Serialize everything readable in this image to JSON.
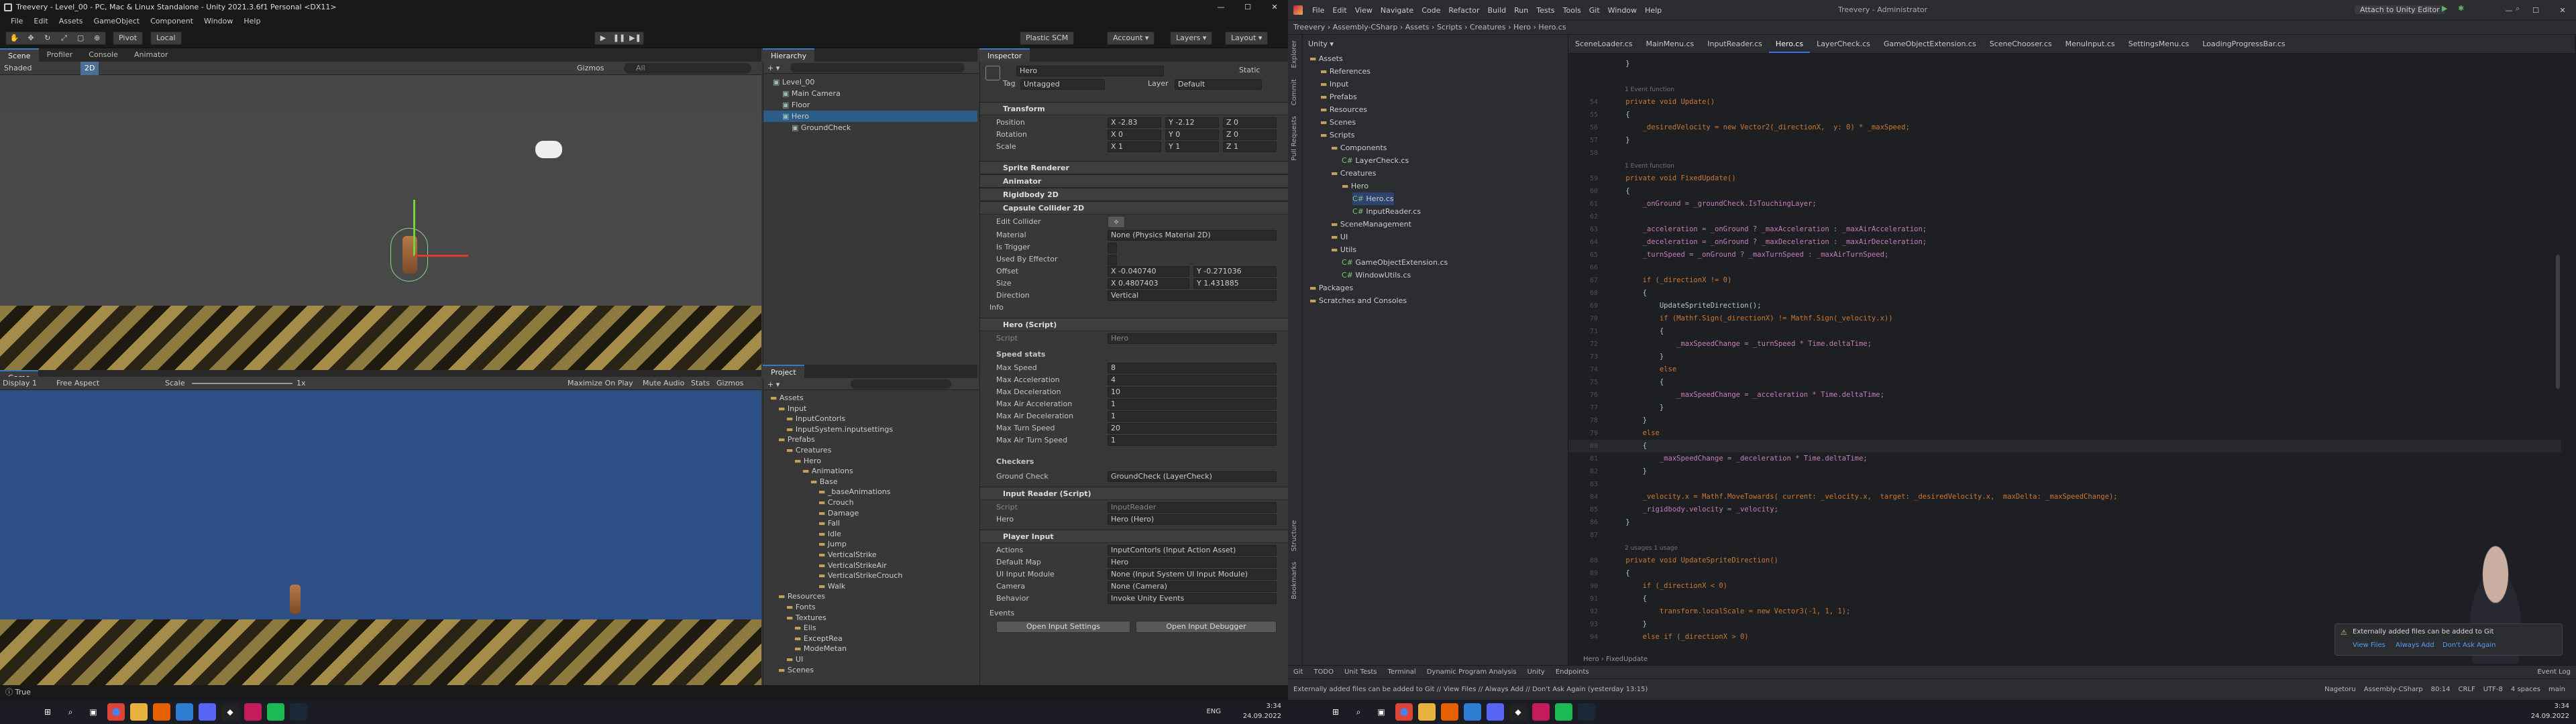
{
  "unity": {
    "title": "Treevery - Level_00 - PC, Mac & Linux Standalone - Unity 2021.3.6f1 Personal <DX11>",
    "menu": [
      "File",
      "Edit",
      "Assets",
      "GameObject",
      "Component",
      "Window",
      "Help"
    ],
    "toolbar": {
      "pivot": "Pivot",
      "local": "Local",
      "scm": "Plastic SCM",
      "account": "Account",
      "layers": "Layers",
      "layout": "Layout"
    },
    "scene_tabs": [
      "Scene",
      "Profiler",
      "Console",
      "Animator"
    ],
    "scene_bar": {
      "shading": "Shaded",
      "mode": "2D",
      "gizmos": "Gizmos",
      "search_ph": "All"
    },
    "game_tab": "Game",
    "game_bar": {
      "display": "Display 1",
      "aspect": "Free Aspect",
      "scale_label": "Scale",
      "scale_value": "1x",
      "maximize": "Maximize On Play",
      "mute": "Mute Audio",
      "stats": "Stats",
      "gizmos": "Gizmos"
    },
    "hierarchy": {
      "tab": "Hierarchy",
      "items": [
        {
          "label": "Level_00",
          "depth": 0,
          "selected": false
        },
        {
          "label": "Main Camera",
          "depth": 1,
          "selected": false
        },
        {
          "label": "Floor",
          "depth": 1,
          "selected": false
        },
        {
          "label": "Hero",
          "depth": 1,
          "selected": true
        },
        {
          "label": "GroundCheck",
          "depth": 2,
          "selected": false
        }
      ]
    },
    "project": {
      "tab": "Project",
      "items": [
        {
          "label": "Assets",
          "depth": 0
        },
        {
          "label": "Input",
          "depth": 1
        },
        {
          "label": "InputContorls",
          "depth": 2
        },
        {
          "label": "InputSystem.inputsettings",
          "depth": 2
        },
        {
          "label": "Prefabs",
          "depth": 1
        },
        {
          "label": "Creatures",
          "depth": 2
        },
        {
          "label": "Hero",
          "depth": 3
        },
        {
          "label": "Animations",
          "depth": 4
        },
        {
          "label": "Base",
          "depth": 5
        },
        {
          "label": "_baseAnimations",
          "depth": 6
        },
        {
          "label": "Crouch",
          "depth": 6
        },
        {
          "label": "Damage",
          "depth": 6
        },
        {
          "label": "Fall",
          "depth": 6
        },
        {
          "label": "Idle",
          "depth": 6
        },
        {
          "label": "Jump",
          "depth": 6
        },
        {
          "label": "VerticalStrike",
          "depth": 6
        },
        {
          "label": "VerticalStrikeAir",
          "depth": 6
        },
        {
          "label": "VerticalStrikeCrouch",
          "depth": 6
        },
        {
          "label": "Walk",
          "depth": 6
        },
        {
          "label": "Resources",
          "depth": 1
        },
        {
          "label": "Fonts",
          "depth": 2
        },
        {
          "label": "Textures",
          "depth": 2
        },
        {
          "label": "Elis",
          "depth": 3
        },
        {
          "label": "ExceptRea",
          "depth": 3
        },
        {
          "label": "ModeMetan",
          "depth": 3
        },
        {
          "label": "UI",
          "depth": 2
        },
        {
          "label": "Scenes",
          "depth": 1
        }
      ]
    },
    "inspector": {
      "tab": "Inspector",
      "object_name": "Hero",
      "static_label": "Static",
      "tag_label": "Tag",
      "tag_value": "Untagged",
      "layer_label": "Layer",
      "layer_value": "Default",
      "transform": {
        "title": "Transform",
        "position": {
          "label": "Position",
          "x": "-2.83",
          "y": "-2.12",
          "z": "0"
        },
        "rotation": {
          "label": "Rotation",
          "x": "0",
          "y": "0",
          "z": "0"
        },
        "scale": {
          "label": "Scale",
          "x": "1",
          "y": "1",
          "z": "1"
        }
      },
      "sprite_renderer": "Sprite Renderer",
      "animator": "Animator",
      "rigidbody": "Rigidbody 2D",
      "capsule": {
        "title": "Capsule Collider 2D",
        "edit_collider": "Edit Collider",
        "material_label": "Material",
        "material_value": "None (Physics Material 2D)",
        "is_trigger": "Is Trigger",
        "used_by_effector": "Used By Effector",
        "offset_label": "Offset",
        "offset_x": "-0.040740",
        "offset_y": "-0.271036",
        "size_label": "Size",
        "size_x": "0.4807403",
        "size_y": "1.431885",
        "direction_label": "Direction",
        "direction_value": "Vertical",
        "info": "Info"
      },
      "hero_script": {
        "title": "Hero (Script)",
        "script_label": "Script",
        "script_value": "Hero",
        "speed_header": "Speed stats",
        "stats": [
          {
            "label": "Max Speed",
            "value": "8"
          },
          {
            "label": "Max Acceleration",
            "value": "4"
          },
          {
            "label": "Max Deceleration",
            "value": "10"
          },
          {
            "label": "Max Air Acceleration",
            "value": "1"
          },
          {
            "label": "Max Air Deceleration",
            "value": "1"
          },
          {
            "label": "Max Turn Speed",
            "value": "20"
          },
          {
            "label": "Max Air Turn Speed",
            "value": "1"
          }
        ],
        "checkers_header": "Checkers",
        "ground_check_label": "Ground Check",
        "ground_check_value": "GroundCheck (LayerCheck)"
      },
      "input_reader": {
        "title": "Input Reader (Script)",
        "script_label": "Script",
        "script_value": "InputReader",
        "hero_label": "Hero",
        "hero_value": "Hero (Hero)"
      },
      "player_input": {
        "title": "Player Input",
        "rows": [
          {
            "label": "Actions",
            "value": "InputContorls (Input Action Asset)"
          },
          {
            "label": "Default Map",
            "value": "Hero"
          },
          {
            "label": "UI Input Module",
            "value": "None (Input System UI Input Module)"
          },
          {
            "label": "Camera",
            "value": "None (Camera)"
          },
          {
            "label": "Behavior",
            "value": "Invoke Unity Events"
          }
        ],
        "events": "Events",
        "open_settings": "Open Input Settings",
        "open_debugger": "Open Input Debugger"
      }
    },
    "status": "True"
  },
  "rider": {
    "title": "Treevery - Administrator",
    "project_name": "Treevery",
    "solution_label": "Assembly-CSharp",
    "menu": [
      "File",
      "Edit",
      "View",
      "Navigate",
      "Code",
      "Refactor",
      "Build",
      "Run",
      "Tests",
      "Tools",
      "Git",
      "Window",
      "Help"
    ],
    "run_config": "Attach to Unity Editor",
    "breadcrumbs": [
      "Treevery",
      "Assembly-CSharp",
      "Assets",
      "Scripts",
      "Creatures",
      "Hero",
      "Hero.cs"
    ],
    "sidebar": [
      "Explorer",
      "Commit",
      "Pull Requests",
      "Structure",
      "Bookmarks"
    ],
    "unity_label": "Unity",
    "tree": [
      {
        "label": "Assets",
        "depth": 0
      },
      {
        "label": "References",
        "depth": 1
      },
      {
        "label": "Input",
        "depth": 1
      },
      {
        "label": "Prefabs",
        "depth": 1
      },
      {
        "label": "Resources",
        "depth": 1
      },
      {
        "label": "Scenes",
        "depth": 1
      },
      {
        "label": "Scripts",
        "depth": 1
      },
      {
        "label": "Components",
        "depth": 2
      },
      {
        "label": "LayerCheck.cs",
        "depth": 3
      },
      {
        "label": "Creatures",
        "depth": 2
      },
      {
        "label": "Hero",
        "depth": 3
      },
      {
        "label": "Hero.cs",
        "depth": 4
      },
      {
        "label": "InputReader.cs",
        "depth": 4
      },
      {
        "label": "SceneManagement",
        "depth": 2
      },
      {
        "label": "UI",
        "depth": 2
      },
      {
        "label": "Utils",
        "depth": 2
      },
      {
        "label": "GameObjectExtension.cs",
        "depth": 3
      },
      {
        "label": "WindowUtils.cs",
        "depth": 3
      },
      {
        "label": "Packages",
        "depth": 0
      },
      {
        "label": "Scratches and Consoles",
        "depth": 0
      }
    ],
    "tabs": [
      "SceneLoader.cs",
      "MainMenu.cs",
      "InputReader.cs",
      "Hero.cs",
      "LayerCheck.cs",
      "GameObjectExtension.cs",
      "SceneChooser.cs",
      "MenuInput.cs",
      "SettingsMenu.cs",
      "LoadingProgressBar.cs"
    ],
    "active_tab": 3,
    "code": [
      {
        "n": "",
        "t": "    }",
        "hint": ""
      },
      {
        "n": "",
        "t": "",
        "hint": ""
      },
      {
        "n": "",
        "t": "",
        "hint": "1 Event function"
      },
      {
        "n": "54",
        "t": "    private void Update()",
        "hint": ""
      },
      {
        "n": "55",
        "t": "    {",
        "hint": ""
      },
      {
        "n": "56",
        "t": "        _desiredVelocity = new Vector2(_directionX,  y: 0) * _maxSpeed;",
        "hint": ""
      },
      {
        "n": "57",
        "t": "    }",
        "hint": ""
      },
      {
        "n": "58",
        "t": "",
        "hint": ""
      },
      {
        "n": "",
        "t": "",
        "hint": "1 Event function"
      },
      {
        "n": "59",
        "t": "    private void FixedUpdate()",
        "hint": ""
      },
      {
        "n": "60",
        "t": "    {",
        "hint": ""
      },
      {
        "n": "61",
        "t": "        _onGround = _groundCheck.IsTouchingLayer;",
        "hint": ""
      },
      {
        "n": "62",
        "t": "",
        "hint": ""
      },
      {
        "n": "63",
        "t": "        _acceleration = _onGround ? _maxAcceleration : _maxAirAcceleration;",
        "hint": ""
      },
      {
        "n": "64",
        "t": "        _deceleration = _onGround ? _maxDeceleration : _maxAirDeceleration;",
        "hint": ""
      },
      {
        "n": "65",
        "t": "        _turnSpeed = _onGround ? _maxTurnSpeed : _maxAirTurnSpeed;",
        "hint": ""
      },
      {
        "n": "66",
        "t": "",
        "hint": ""
      },
      {
        "n": "67",
        "t": "        if (_directionX != 0)",
        "hint": ""
      },
      {
        "n": "68",
        "t": "        {",
        "hint": ""
      },
      {
        "n": "69",
        "t": "            UpdateSpriteDirection();",
        "hint": ""
      },
      {
        "n": "70",
        "t": "            if (Mathf.Sign(_directionX) != Mathf.Sign(_velocity.x))",
        "hint": ""
      },
      {
        "n": "71",
        "t": "            {",
        "hint": ""
      },
      {
        "n": "72",
        "t": "                _maxSpeedChange = _turnSpeed * Time.deltaTime;",
        "hint": ""
      },
      {
        "n": "73",
        "t": "            }",
        "hint": ""
      },
      {
        "n": "74",
        "t": "            else",
        "hint": ""
      },
      {
        "n": "75",
        "t": "            {",
        "hint": ""
      },
      {
        "n": "76",
        "t": "                _maxSpeedChange = _acceleration * Time.deltaTime;",
        "hint": ""
      },
      {
        "n": "77",
        "t": "            }",
        "hint": ""
      },
      {
        "n": "78",
        "t": "        }",
        "hint": ""
      },
      {
        "n": "79",
        "t": "        else",
        "hint": ""
      },
      {
        "n": "80",
        "t": "        {",
        "hint": ""
      },
      {
        "n": "81",
        "t": "            _maxSpeedChange = _deceleration * Time.deltaTime;",
        "hint": ""
      },
      {
        "n": "82",
        "t": "        }",
        "hint": ""
      },
      {
        "n": "83",
        "t": "",
        "hint": ""
      },
      {
        "n": "84",
        "t": "        _velocity.x = Mathf.MoveTowards( current: _velocity.x,  target: _desiredVelocity.x,  maxDelta: _maxSpeedChange);",
        "hint": ""
      },
      {
        "n": "85",
        "t": "        _rigidbody.velocity = _velocity;",
        "hint": ""
      },
      {
        "n": "86",
        "t": "    }",
        "hint": ""
      },
      {
        "n": "87",
        "t": "",
        "hint": ""
      },
      {
        "n": "",
        "t": "",
        "hint": "2 usages  1 usage"
      },
      {
        "n": "88",
        "t": "    private void UpdateSpriteDirection()",
        "hint": ""
      },
      {
        "n": "89",
        "t": "    {",
        "hint": ""
      },
      {
        "n": "90",
        "t": "        if (_directionX < 0)",
        "hint": ""
      },
      {
        "n": "91",
        "t": "        {",
        "hint": ""
      },
      {
        "n": "92",
        "t": "            transform.localScale = new Vector3(-1, 1, 1);",
        "hint": ""
      },
      {
        "n": "93",
        "t": "        }",
        "hint": ""
      },
      {
        "n": "94",
        "t": "        else if (_directionX > 0)",
        "hint": ""
      }
    ],
    "breadcrumb_bottom": [
      "Hero",
      "FixedUpdate"
    ],
    "notification": {
      "title": "Externally added files can be added to Git",
      "links": [
        "View Files",
        "Always Add",
        "Don't Ask Again"
      ]
    },
    "bottom_tools": [
      "Git",
      "TODO",
      "Unit Tests",
      "Terminal",
      "Dynamic Program Analysis",
      "Unity",
      "Endpoints"
    ],
    "event_log": "Event Log",
    "status_msg": "Externally added files can be added to Git // View Files // Always Add // Don't Ask Again (yesterday 13:15)",
    "status_right": [
      "Nagetoru",
      "Assembly-CSharp",
      "80:14",
      "CRLF",
      "UTF-8",
      "4 spaces",
      "main"
    ]
  },
  "taskbar_left": {
    "lang": "ENG",
    "time": "3:34",
    "date": "24.09.2022"
  },
  "taskbar_right": {
    "time": "3:34",
    "date": "24.09.2022"
  },
  "colors": {
    "accent": "#3a79bb",
    "selection": "#2c5d87",
    "rider_accent": "#3574f0",
    "game_bg": "#2e4e86"
  }
}
